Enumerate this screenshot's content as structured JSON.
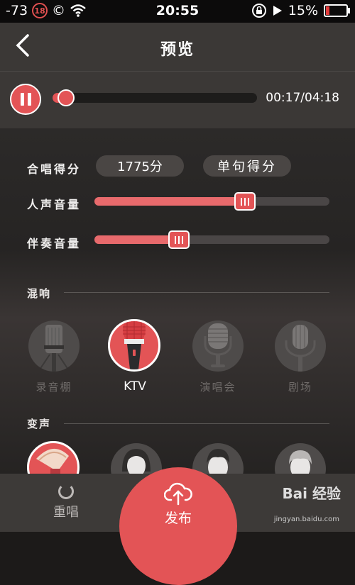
{
  "status_bar": {
    "signal": "-73",
    "badge": "18",
    "copyright": "©",
    "time": "20:55",
    "battery": "15%"
  },
  "nav": {
    "title": "预览"
  },
  "player": {
    "time": "00:17/04:18",
    "progress": 0.066
  },
  "score": {
    "label": "合唱得分",
    "value": "1775分",
    "per_line_button": "单句得分"
  },
  "vocal": {
    "label": "人声音量",
    "level": 0.64
  },
  "accompaniment": {
    "label": "伴奏音量",
    "level": 0.36
  },
  "reverb": {
    "section": "混响",
    "items": [
      {
        "label": "录音棚",
        "icon": "studio-mic-icon",
        "selected": false
      },
      {
        "label": "KTV",
        "icon": "ktv-mic-icon",
        "selected": true
      },
      {
        "label": "演唱会",
        "icon": "concert-mic-icon",
        "selected": false
      },
      {
        "label": "剧场",
        "icon": "theater-mic-icon",
        "selected": false
      }
    ]
  },
  "voice_change": {
    "section": "变声",
    "items": [
      {
        "icon": "gramophone-icon",
        "selected": true
      },
      {
        "icon": "female-avatar-icon",
        "selected": false
      },
      {
        "icon": "male-avatar-icon",
        "selected": false
      },
      {
        "icon": "elder-avatar-icon",
        "selected": false
      }
    ]
  },
  "bottom": {
    "redo_label": "重唱",
    "publish_label": "发布"
  },
  "watermark": {
    "brand": "Bai 经验",
    "url": "jingyan.baidu.com"
  },
  "colors": {
    "accent": "#e35456",
    "panel": "#3b3836",
    "background": "#1c1a19"
  }
}
